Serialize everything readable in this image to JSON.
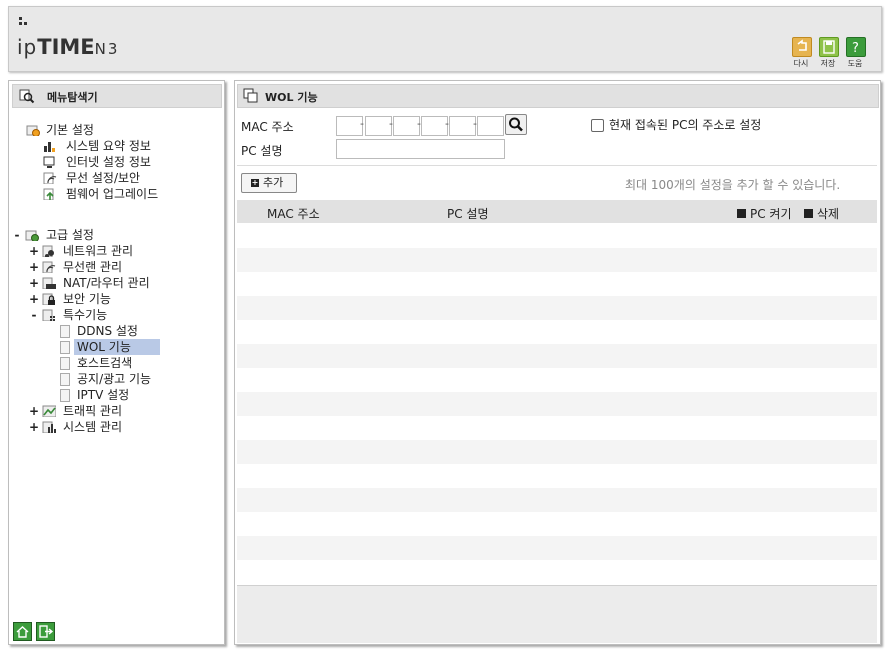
{
  "header": {
    "logo_prefix": "ip",
    "logo_bold": "TIME",
    "logo_model": "N3",
    "buttons": [
      {
        "label": "다시",
        "icon": "undo-icon",
        "color": "#e6b450"
      },
      {
        "label": "저장",
        "icon": "save-icon",
        "color": "#8fc24a"
      },
      {
        "label": "도움",
        "icon": "help-icon",
        "color": "#3c9c3c"
      }
    ]
  },
  "sidebar": {
    "title": "메뉴탐색기",
    "basic": {
      "label": "기본 설정",
      "items": [
        "시스템 요약 정보",
        "인터넷 설정 정보",
        "무선 설정/보안",
        "펌웨어 업그레이드"
      ]
    },
    "advanced": {
      "label": "고급 설정",
      "items": [
        {
          "label": "네트워크 관리",
          "toggle": "+"
        },
        {
          "label": "무선랜 관리",
          "toggle": "+"
        },
        {
          "label": "NAT/라우터 관리",
          "toggle": "+"
        },
        {
          "label": "보안 기능",
          "toggle": "+"
        },
        {
          "label": "특수기능",
          "toggle": "-"
        }
      ],
      "special_children": [
        "DDNS 설정",
        "WOL 기능",
        "호스트검색",
        "공지/광고 기능",
        "IPTV 설정"
      ],
      "selected": "WOL 기능",
      "after": [
        {
          "label": "트래픽 관리",
          "toggle": "+"
        },
        {
          "label": "시스템 관리",
          "toggle": "+"
        }
      ],
      "toggle": "-"
    },
    "footer_icons": [
      "home-icon",
      "logout-icon"
    ]
  },
  "main": {
    "title": "WOL 기능",
    "mac_label": "MAC 주소",
    "mac_fields": [
      "",
      "",
      "",
      "",
      "",
      ""
    ],
    "mac_separator": "-",
    "pc_label": "PC 설명",
    "pc_value": "",
    "checkbox_label": "현재 접속된 PC의 주소로 설정",
    "checkbox_checked": false,
    "add_button": "추가",
    "add_icon_glyph": "+",
    "limit_note": "최대 100개의 설정을 추가 할 수 있습니다.",
    "table": {
      "columns": [
        "MAC 주소",
        "PC 설명",
        "PC 켜기",
        "삭제"
      ],
      "rows": []
    }
  }
}
